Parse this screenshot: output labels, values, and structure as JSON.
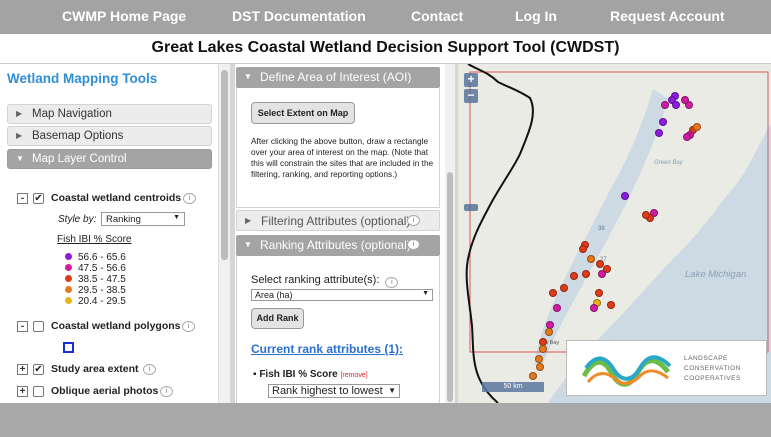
{
  "nav": {
    "items": [
      "CWMP Home Page",
      "DST Documentation",
      "Contact",
      "Log In",
      "Request Account"
    ]
  },
  "title": "Great Lakes Coastal Wetland Decision Support Tool (CWDST)",
  "left_panel": {
    "title": "Wetland Mapping Tools",
    "sections": [
      "Map Navigation",
      "Basemap Options",
      "Map Layer Control"
    ],
    "layers": {
      "centroids": {
        "label": "Coastal wetland centroids",
        "style_by_label": "Style by:",
        "style_by_value": "Ranking",
        "legend_title": "Fish IBI % Score",
        "legend": [
          {
            "label": "56.6 - 65.6",
            "color": "#8e1be0"
          },
          {
            "label": "47.5 - 56.6",
            "color": "#d11ba3"
          },
          {
            "label": "38.5 - 47.5",
            "color": "#e03a1b"
          },
          {
            "label": "29.5 - 38.5",
            "color": "#e7781b"
          },
          {
            "label": "20.4 - 29.5",
            "color": "#e6b419"
          }
        ]
      },
      "polygons": {
        "label": "Coastal wetland polygons"
      },
      "study_area": {
        "label": "Study area extent"
      },
      "oblique": {
        "label": "Oblique aerial photos"
      }
    }
  },
  "middle_panel": {
    "aoi": {
      "header": "Define Area of Interest (AOI)",
      "button": "Select Extent on Map",
      "instructions": "After clicking the above button, draw a rectangle over your area of interest on the map. (Note that this will constrain the sites that are included in the filtering, ranking, and reporting options.)"
    },
    "filtering": {
      "header": "Filtering Attributes (optional)"
    },
    "ranking": {
      "header": "Ranking Attributes (optional)",
      "select_label": "Select ranking attribute(s):",
      "select_value": "Area (ha)",
      "add_button": "Add Rank",
      "current_title": "Current rank attributes (1):",
      "current_item": "Fish IBI % Score",
      "remove_label": "[remove]",
      "order_value": "Rank highest to lowest"
    }
  },
  "map": {
    "zoom_in": "+",
    "zoom_out": "−",
    "labels": {
      "green_bay": "Green Bay",
      "lake_michigan": "Lake Michigan",
      "road_1": "38",
      "road_2": "27",
      "town": "an Bay"
    },
    "scale": "50 km",
    "logo": {
      "line1": "LANDSCAPE",
      "line2": "CONSERVATION",
      "line3": "COOPERATIVES"
    },
    "points": [
      {
        "x": 0.693,
        "y": 0.095,
        "c": "#8e1be0"
      },
      {
        "x": 0.683,
        "y": 0.105,
        "c": "#8e1be0"
      },
      {
        "x": 0.662,
        "y": 0.12,
        "c": "#d11ba3"
      },
      {
        "x": 0.698,
        "y": 0.12,
        "c": "#8e1be0"
      },
      {
        "x": 0.738,
        "y": 0.12,
        "c": "#d11ba3"
      },
      {
        "x": 0.725,
        "y": 0.105,
        "c": "#d11ba3"
      },
      {
        "x": 0.655,
        "y": 0.17,
        "c": "#8e1be0"
      },
      {
        "x": 0.643,
        "y": 0.205,
        "c": "#8e1be0"
      },
      {
        "x": 0.75,
        "y": 0.195,
        "c": "#e03a1b"
      },
      {
        "x": 0.762,
        "y": 0.185,
        "c": "#e7781b"
      },
      {
        "x": 0.742,
        "y": 0.21,
        "c": "#d11ba3"
      },
      {
        "x": 0.732,
        "y": 0.215,
        "c": "#d11ba3"
      },
      {
        "x": 0.535,
        "y": 0.39,
        "c": "#8e1be0"
      },
      {
        "x": 0.625,
        "y": 0.44,
        "c": "#d11ba3"
      },
      {
        "x": 0.612,
        "y": 0.455,
        "c": "#e03a1b"
      },
      {
        "x": 0.602,
        "y": 0.445,
        "c": "#e03a1b"
      },
      {
        "x": 0.405,
        "y": 0.535,
        "c": "#e03a1b"
      },
      {
        "x": 0.398,
        "y": 0.545,
        "c": "#e03a1b"
      },
      {
        "x": 0.425,
        "y": 0.575,
        "c": "#e7781b"
      },
      {
        "x": 0.455,
        "y": 0.59,
        "c": "#e03a1b"
      },
      {
        "x": 0.475,
        "y": 0.605,
        "c": "#e03a1b"
      },
      {
        "x": 0.46,
        "y": 0.62,
        "c": "#d11ba3"
      },
      {
        "x": 0.41,
        "y": 0.62,
        "c": "#e03a1b"
      },
      {
        "x": 0.37,
        "y": 0.625,
        "c": "#e03a1b"
      },
      {
        "x": 0.34,
        "y": 0.66,
        "c": "#e03a1b"
      },
      {
        "x": 0.305,
        "y": 0.675,
        "c": "#e03a1b"
      },
      {
        "x": 0.45,
        "y": 0.675,
        "c": "#e03a1b"
      },
      {
        "x": 0.445,
        "y": 0.705,
        "c": "#e6b419"
      },
      {
        "x": 0.435,
        "y": 0.72,
        "c": "#d11ba3"
      },
      {
        "x": 0.49,
        "y": 0.71,
        "c": "#e03a1b"
      },
      {
        "x": 0.315,
        "y": 0.72,
        "c": "#d11ba3"
      },
      {
        "x": 0.295,
        "y": 0.77,
        "c": "#d11ba3"
      },
      {
        "x": 0.29,
        "y": 0.79,
        "c": "#e7781b"
      },
      {
        "x": 0.27,
        "y": 0.82,
        "c": "#e03a1b"
      },
      {
        "x": 0.272,
        "y": 0.84,
        "c": "#e7781b"
      },
      {
        "x": 0.258,
        "y": 0.87,
        "c": "#e7781b"
      },
      {
        "x": 0.262,
        "y": 0.895,
        "c": "#e7781b"
      },
      {
        "x": 0.24,
        "y": 0.92,
        "c": "#e7781b"
      }
    ]
  }
}
